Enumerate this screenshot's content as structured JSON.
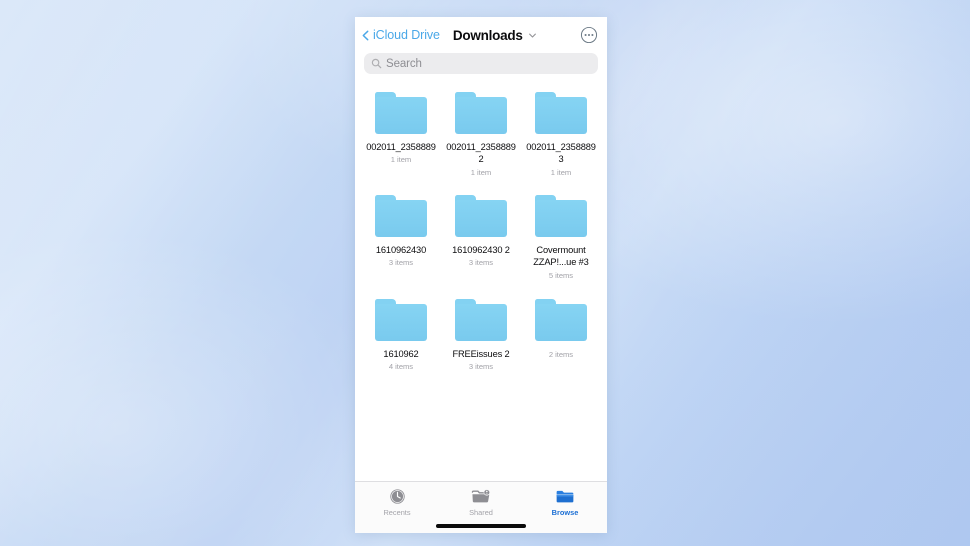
{
  "window": {
    "app_name": "Files"
  },
  "header": {
    "back_label": "iCloud Drive",
    "back_icon": "chevron-left-icon",
    "folder_title": "Downloads",
    "dropdown_icon": "chevron-down-icon",
    "more_icon": "ellipsis-circle-icon"
  },
  "search": {
    "placeholder": "Search",
    "value": "",
    "icon": "search-icon"
  },
  "files": {
    "rows": [
      [
        {
          "name": "002011_2358889",
          "count": "1 item",
          "icon": "folder-icon"
        },
        {
          "name": "002011_2358889 2",
          "count": "1 item",
          "icon": "folder-icon"
        },
        {
          "name": "002011_2358889 3",
          "count": "1 item",
          "icon": "folder-icon"
        }
      ],
      [
        {
          "name": "1610962430",
          "count": "3 items",
          "icon": "folder-icon"
        },
        {
          "name": "1610962430 2",
          "count": "3 items",
          "icon": "folder-icon"
        },
        {
          "name": "Covermount ZZAP!...ue #3",
          "count": "5 items",
          "icon": "folder-icon"
        }
      ],
      [
        {
          "name": "1610962",
          "count": "4 items",
          "icon": "folder-icon"
        },
        {
          "name": "FREEissues 2",
          "count": "3 items",
          "icon": "folder-icon"
        },
        {
          "name": "",
          "count": "2 items",
          "icon": "folder-icon"
        }
      ]
    ]
  },
  "tab_bar": {
    "items": [
      {
        "label": "Recents",
        "icon": "clock-icon",
        "active": false
      },
      {
        "label": "Shared",
        "icon": "folder-person-icon",
        "active": false
      },
      {
        "label": "Browse",
        "icon": "folder-filled-icon",
        "active": true
      }
    ]
  },
  "colors": {
    "accent": "#0b84ff",
    "back_link": "#4aa8e8",
    "folder_blue": "#83d2f2",
    "tab_active": "#1c6fd4",
    "tab_inactive": "#a3a3a9",
    "search_bg": "#ececee",
    "count_text": "#a2a2a8"
  }
}
